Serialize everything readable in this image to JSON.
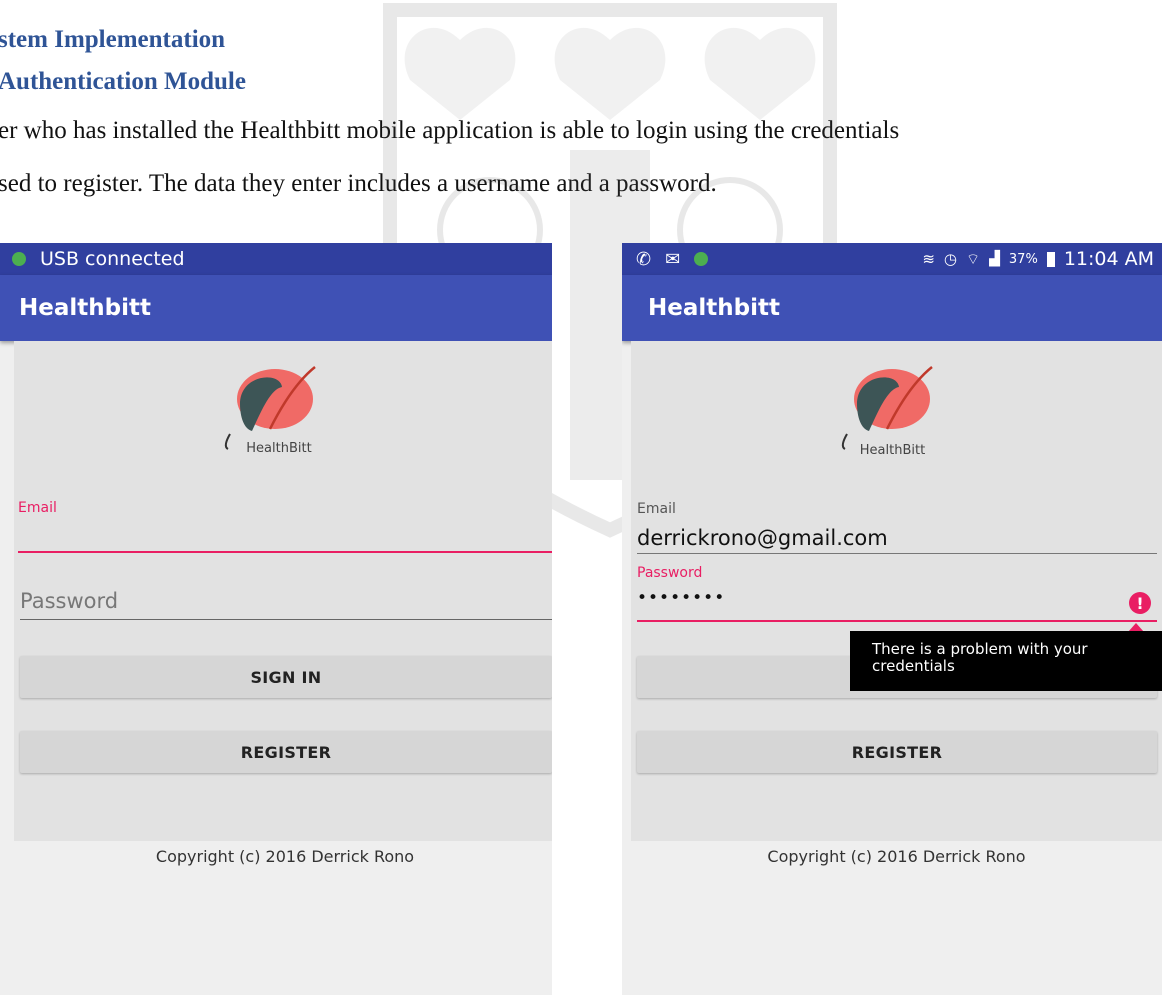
{
  "document": {
    "heading1": "stem Implementation",
    "heading2": "Authentication Module",
    "line1": "er who has installed the Healthbitt mobile application is able to login using the credentials",
    "line2": "sed to register. The data they enter includes a username and a password."
  },
  "screen_left": {
    "status_bar": {
      "text": "USB connected"
    },
    "app_title": "Healthbitt",
    "logo_text": "HealthBitt",
    "email_label": "Email",
    "password_placeholder": "Password",
    "sign_in_label": "SIGN IN",
    "register_label": "REGISTER",
    "copyright": "Copyright (c) 2016 Derrick Rono"
  },
  "screen_right": {
    "status_bar": {
      "battery": "37%",
      "time": "11:04 AM",
      "icons": [
        "whatsapp-icon",
        "mail-icon",
        "globe-icon",
        "vibrate-icon",
        "alarm-icon",
        "wifi-icon",
        "signal-icon",
        "battery-icon"
      ]
    },
    "app_title": "Healthbitt",
    "logo_text": "HealthBitt",
    "email_label": "Email",
    "email_value": "derrickrono@gmail.com",
    "password_label": "Password",
    "password_value": "••••••••",
    "error_tooltip": "There is a problem with your credentials",
    "sign_in_partial": "S",
    "register_label": "REGISTER",
    "copyright": "Copyright (c) 2016 Derrick Rono"
  },
  "colors": {
    "status_bar": "#303f9f",
    "app_bar": "#3f51b5",
    "accent": "#e91e63",
    "heading": "#2f5496"
  }
}
